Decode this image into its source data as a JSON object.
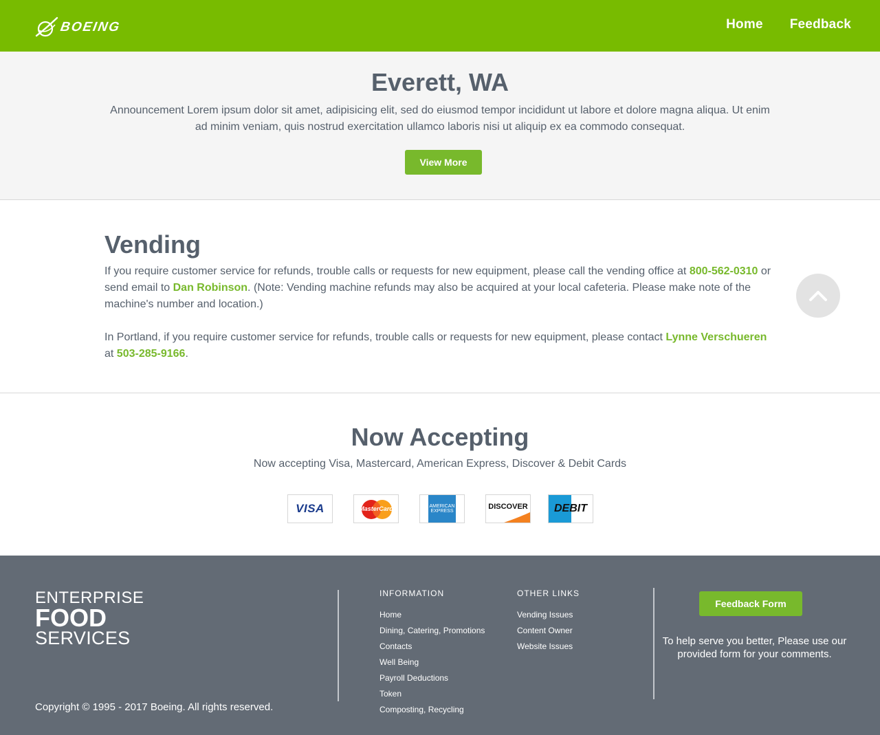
{
  "header": {
    "brand": "BOEING",
    "nav": [
      {
        "label": "Home"
      },
      {
        "label": "Feedback"
      }
    ]
  },
  "announcement": {
    "title": "Everett, WA",
    "text": "Announcement Lorem ipsum dolor sit amet, adipisicing elit, sed do eiusmod tempor incididunt ut labore et dolore magna aliqua. Ut enim ad minim veniam, quis nostrud exercitation ullamco laboris nisi ut aliquip ex ea commodo consequat.",
    "button": "View More"
  },
  "vending": {
    "title": "Vending",
    "p1_a": "If you require customer service for refunds, trouble calls or requests for new equipment, please call the vending office at ",
    "p1_phone": "800-562-0310",
    "p1_b": " or send email to ",
    "p1_contact": "Dan Robinson",
    "p1_c": ". (Note: Vending machine refunds may also be acquired at your local cafeteria. Please make note of the machine's number and location.)",
    "p2_a": "In Portland, if you require customer service for refunds, trouble calls or requests for new equipment, please contact ",
    "p2_contact": "Lynne Verschueren",
    "p2_b": " at ",
    "p2_phone": "503-285-9166",
    "p2_c": "."
  },
  "accepting": {
    "title": "Now Accepting",
    "text": "Now accepting Visa, Mastercard, American Express, Discover & Debit Cards",
    "cards": {
      "visa": "VISA",
      "mastercard": "MasterCard",
      "amex_1": "AMERICAN",
      "amex_2": "EXPRESS",
      "discover": "DISCOVER",
      "debit": "DEBIT"
    }
  },
  "footer": {
    "logo": {
      "line1": "ENTERPRISE",
      "line2": "FOOD",
      "line3": "SERVICES"
    },
    "copyright": "Copyright © 1995 - 2017 Boeing. All rights reserved.",
    "information": {
      "heading": "INFORMATION",
      "links": [
        "Home",
        "Dining, Catering, Promotions",
        "Contacts",
        "Well Being",
        "Payroll Deductions",
        "Token",
        "Composting, Recycling"
      ]
    },
    "other_links": {
      "heading": "OTHER LINKS",
      "links": [
        "Vending Issues",
        "Content Owner",
        "Website Issues"
      ]
    },
    "feedback_button": "Feedback Form",
    "help_text": "To help serve you better, Please use our provided form for your comments."
  },
  "colors": {
    "brand_green": "#78bb00",
    "link_green": "#78b92c",
    "text": "#56606c",
    "footer_bg": "#636b75"
  }
}
